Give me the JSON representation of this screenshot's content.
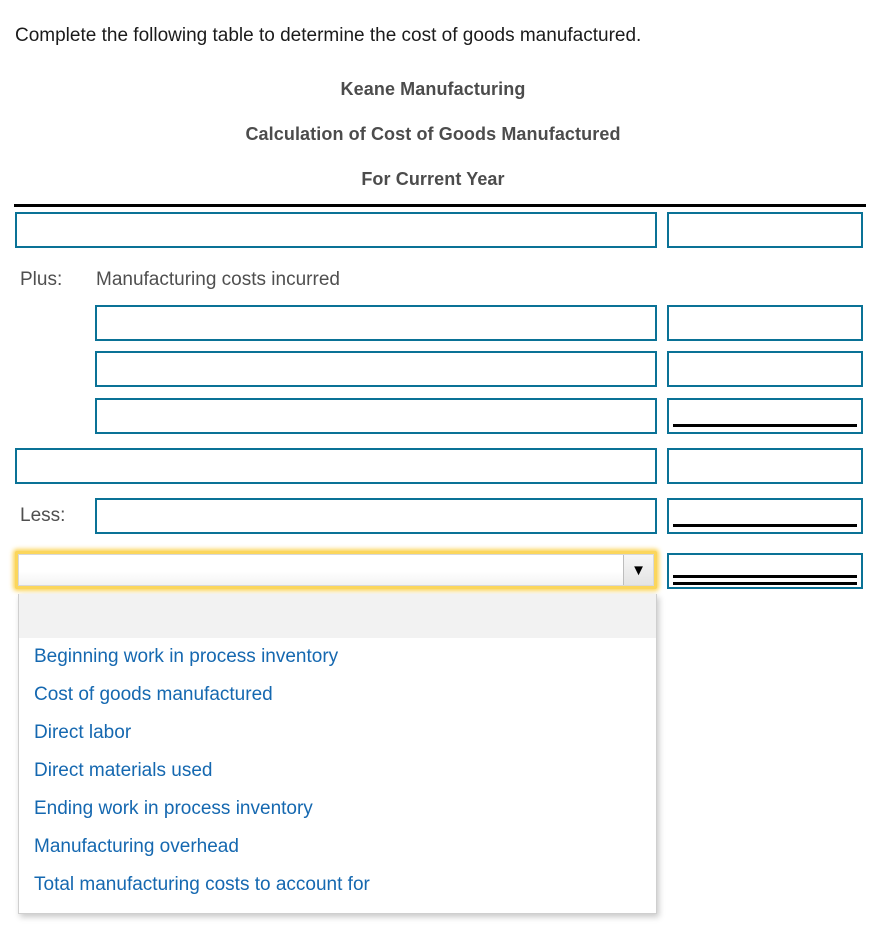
{
  "instruction": "Complete the following table to determine the cost of goods manufactured.",
  "statement": {
    "company": "Keane Manufacturing",
    "title": "Calculation of Cost of Goods Manufactured",
    "period": "For Current Year"
  },
  "labels": {
    "plus": "Plus:",
    "plus_caption": "Manufacturing costs incurred",
    "less": "Less:"
  },
  "rows": [
    {
      "description": "",
      "amount": "",
      "underline": "none"
    },
    {
      "description": "",
      "amount": "",
      "underline": "none"
    },
    {
      "description": "",
      "amount": "",
      "underline": "none"
    },
    {
      "description": "",
      "amount": "",
      "underline": "single"
    },
    {
      "description": "",
      "amount": "",
      "underline": "none"
    },
    {
      "description": "",
      "amount": "",
      "underline": "single"
    },
    {
      "description": "",
      "amount": "",
      "underline": "double"
    }
  ],
  "select": {
    "value": "",
    "placeholder": "",
    "arrow_glyph": "▼",
    "expanded": true,
    "options": [
      "",
      "Beginning work in process inventory",
      "Cost of goods manufactured",
      "Direct labor",
      "Direct materials used",
      "Ending work in process inventory",
      "Manufacturing overhead",
      "Total manufacturing costs to account for"
    ]
  },
  "colors": {
    "input_border": "#0a7296",
    "option_text": "#1568b0",
    "focus_ring": "#fbd65c",
    "heading_text": "#4c4c4c",
    "rule": "#000000"
  }
}
